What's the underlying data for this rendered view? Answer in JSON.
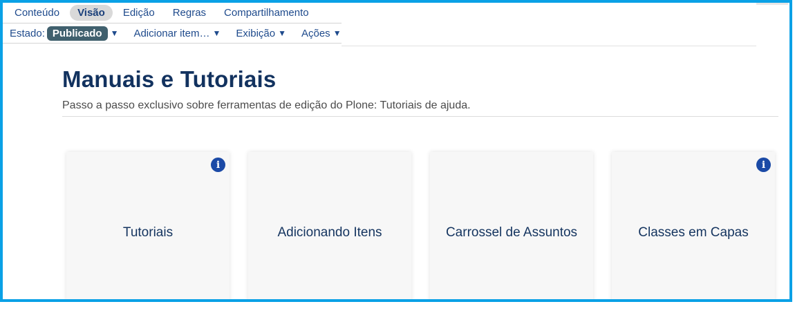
{
  "toolbar": {
    "tabs": [
      {
        "label": "Conteúdo"
      },
      {
        "label": "Visão"
      },
      {
        "label": "Edição"
      },
      {
        "label": "Regras"
      },
      {
        "label": "Compartilhamento"
      }
    ],
    "state_label": "Estado:",
    "state_value": "Publicado",
    "menus": [
      {
        "label": "Adicionar item…"
      },
      {
        "label": "Exibição"
      },
      {
        "label": "Ações"
      }
    ],
    "caret": "▼"
  },
  "page": {
    "title": "Manuais e Tutoriais",
    "description": "Passo a passo exclusivo sobre ferramentas de edição do Plone: Tutoriais de ajuda."
  },
  "cards": [
    {
      "title": "Tutoriais",
      "info": "i"
    },
    {
      "title": "Adicionando Itens"
    },
    {
      "title": "Carrossel de Assuntos"
    },
    {
      "title": "Classes em Capas",
      "info": "i"
    }
  ],
  "colors": {
    "frame_border": "#0aa1e6",
    "link": "#1e4a8c",
    "title": "#12325f",
    "state_pill": "#40606e",
    "info_icon": "#1b4aa6",
    "card_bg": "#f7f7f7"
  }
}
